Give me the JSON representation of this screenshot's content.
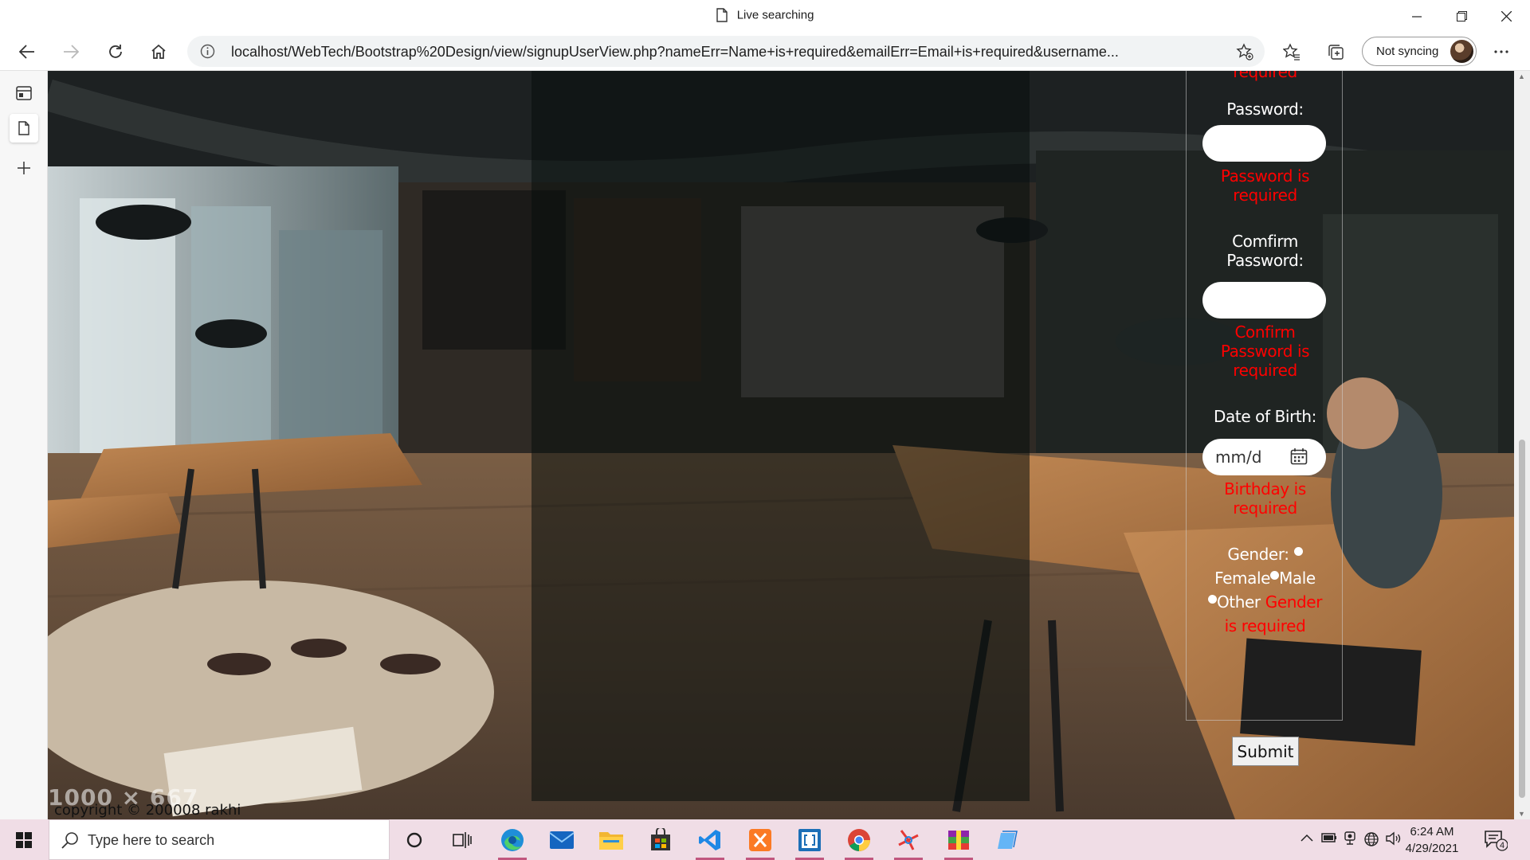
{
  "window": {
    "tab_title": "Live searching"
  },
  "addressbar": {
    "url": "localhost/WebTech/Bootstrap%20Design/view/signupUserView.php?nameErr=Name+is+required&emailErr=Email+is+required&username...",
    "sync_label": "Not syncing"
  },
  "form": {
    "prev_error_tail": "required",
    "password_label": "Password:",
    "password_error_line1": "Password is",
    "password_error_line2": "required",
    "confirm_label_line1": "Comfirm",
    "confirm_label_line2": "Password:",
    "confirm_error_line1": "Confirm",
    "confirm_error_line2": "Password is",
    "confirm_error_line3": "required",
    "dob_label": "Date of Birth:",
    "dob_placeholder": "mm/d",
    "dob_error_line1": "Birthday is",
    "dob_error_line2": "required",
    "gender_label": "Gender:",
    "gender_options": [
      "Female",
      "Male",
      "Other"
    ],
    "gender_error_line1": "Gender",
    "gender_error_line2": "is required",
    "submit_label": "Submit"
  },
  "page_footer": {
    "image_size_overlay": "1000 × 667",
    "copyright": "copyright © 200008 rakhi"
  },
  "taskbar": {
    "search_placeholder": "Type here to search",
    "apps": [
      "cortana-icon",
      "task-view-icon",
      "edge-icon",
      "mail-icon",
      "file-explorer-icon",
      "store-icon",
      "vscode-icon",
      "xampp-icon",
      "brackets-icon",
      "chrome-icon",
      "pinwheel-app-icon",
      "winrar-icon",
      "notes-app-icon"
    ],
    "clock_time": "6:24 AM",
    "clock_date": "4/29/2021",
    "notification_count": "4"
  },
  "colors": {
    "error_text": "#ff0000",
    "label_text": "#ffffff",
    "taskbar_bg": "#f0dde6"
  }
}
